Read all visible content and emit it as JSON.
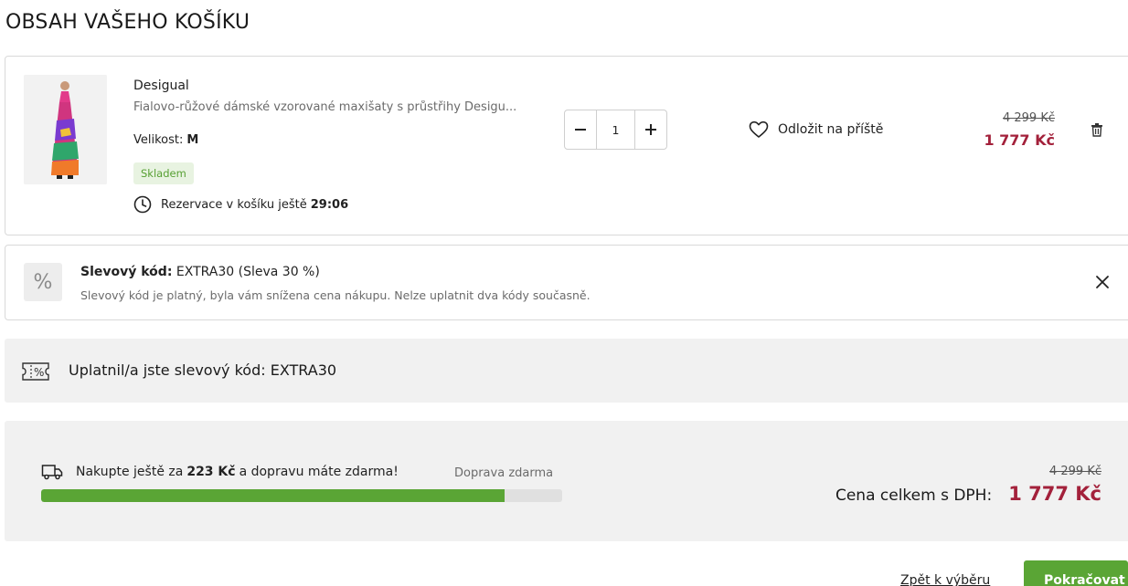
{
  "page": {
    "title": "OBSAH VAŠEHO KOŠÍKU"
  },
  "cart_item": {
    "brand": "Desigual",
    "name": "Fialovo-růžové dámské vzorované maxišaty s průstřihy Desigu...",
    "size_label": "Velikost:",
    "size_value": "M",
    "stock_label": "Skladem",
    "reservation_text": "Rezervace v košíku ještě",
    "reservation_time": "29:06",
    "quantity": "1",
    "save_later_label": "Odložit na příště",
    "old_price": "4 299 Kč",
    "new_price": "1 777 Kč"
  },
  "coupon": {
    "label": "Slevový kód:",
    "code_text": "EXTRA30 (Sleva 30 %)",
    "message": "Slevový kód je platný, byla vám snížena cena nákupu. Nelze uplatnit dva kódy současně.",
    "icon_text": "%"
  },
  "applied": {
    "text": "Uplatnil/a jste slevový kód: EXTRA30"
  },
  "shipping": {
    "text_before": "Nakupte ještě za",
    "amount": "223 Kč",
    "text_after": "a dopravu máte zdarma!",
    "free_label": "Doprava zdarma",
    "progress_fraction": 0.89
  },
  "totals": {
    "old_total": "4 299 Kč",
    "label": "Cena celkem s DPH:",
    "total": "1 777 Kč"
  },
  "actions": {
    "back_label": "Zpět k výběru",
    "continue_label": "Pokračovat"
  },
  "colors": {
    "accent_green": "#5aa535",
    "price_red": "#a3213b",
    "panel_gray": "#f1f1f1"
  }
}
